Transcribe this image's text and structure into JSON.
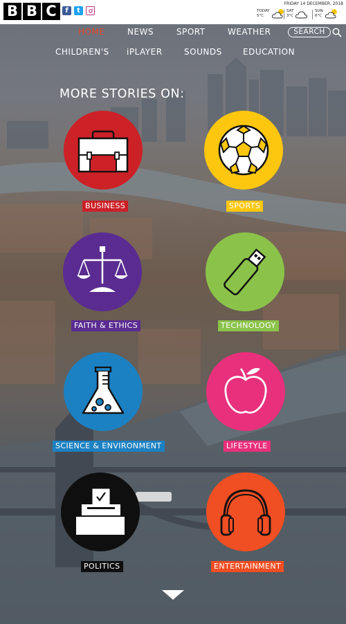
{
  "header": {
    "logo_letters": [
      "B",
      "B",
      "C"
    ],
    "social": [
      {
        "name": "facebook",
        "glyph": "f",
        "color": "#3b5998"
      },
      {
        "name": "twitter",
        "glyph": "t",
        "color": "#1da1f2"
      },
      {
        "name": "instagram",
        "glyph": "",
        "color": "#c13584"
      }
    ],
    "date": "FRIDAY 14 DECEMBER, 2018",
    "forecast": [
      {
        "day": "TODAY",
        "temp": "5°C",
        "icon": "cloud-sun-icon"
      },
      {
        "day": "SAT",
        "temp": "3°C",
        "icon": "cloud-icon"
      },
      {
        "day": "SUN",
        "temp": "6°C",
        "icon": "cloud-sun-icon"
      }
    ]
  },
  "nav": {
    "row1": [
      "HOME",
      "NEWS",
      "SPORT",
      "WEATHER"
    ],
    "row2": [
      "CHILDREN'S",
      "iPLAYER",
      "SOUNDS",
      "EDUCATION"
    ],
    "active": "HOME",
    "active_color": "#e2492c",
    "search_label": "SEARCH"
  },
  "heading": "MORE STORIES ON:",
  "categories": [
    {
      "label": "BUSINESS",
      "color": "#cc2127",
      "icon": "briefcase-icon"
    },
    {
      "label": "SPORTS",
      "color": "#fdc70f",
      "icon": "football-icon"
    },
    {
      "label": "FAITH & ETHICS",
      "color": "#5a2c91",
      "icon": "scales-icon"
    },
    {
      "label": "TECHNOLOGY",
      "color": "#8bc34a",
      "icon": "usb-stick-icon"
    },
    {
      "label": "SCIENCE & ENVIRONMENT",
      "color": "#1c81c2",
      "icon": "flask-icon"
    },
    {
      "label": "LIFESTYLE",
      "color": "#e8307c",
      "icon": "apple-icon"
    },
    {
      "label": "POLITICS",
      "color": "#0f0f0f",
      "icon": "ballot-box-icon"
    },
    {
      "label": "ENTERTAINMENT",
      "color": "#f04e23",
      "icon": "headphones-icon"
    }
  ]
}
